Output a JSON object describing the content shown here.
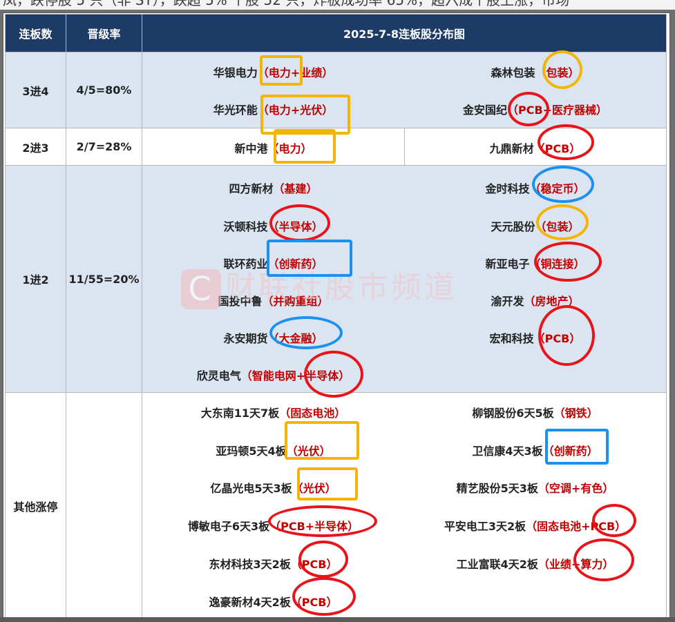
{
  "top_text": "凤，跌停股 5 只（非 ST），跌超 5% 个股 52 只，炸板成功率 65%，超六成个股上涨，市场",
  "header": {
    "col1": "连板数",
    "col2": "晋级率",
    "col3": "2025-7-8连板股分布图"
  },
  "rows": [
    {
      "tier": "3进4",
      "rate": "4/5=80%",
      "left": [
        {
          "name": "华银电力",
          "tag": "（电力+业绩）"
        },
        {
          "name": "华光环能",
          "tag": "（电力+光伏）"
        }
      ],
      "right": [
        {
          "name": "森林包装",
          "tag": "（包装）"
        },
        {
          "name": "金安国纪",
          "tag": "（PCB+医疗器械）"
        }
      ]
    },
    {
      "tier": "2进3",
      "rate": "2/7=28%",
      "left": [
        {
          "name": "新中港",
          "tag": "（电力）"
        }
      ],
      "right": [
        {
          "name": "九鼎新材",
          "tag": "（PCB）"
        }
      ]
    },
    {
      "tier": "1进2",
      "rate": "11/55=20%",
      "left": [
        {
          "name": "四方新材",
          "tag": "（基建）"
        },
        {
          "name": "沃顿科技",
          "tag": "（半导体）"
        },
        {
          "name": "联环药业",
          "tag": "（创新药）"
        },
        {
          "name": "国投中鲁",
          "tag": "（并购重组）"
        },
        {
          "name": "永安期货",
          "tag": "（大金融）"
        },
        {
          "name": "欣灵电气",
          "tag": "（智能电网+半导体）"
        }
      ],
      "right": [
        {
          "name": "金时科技",
          "tag": "（稳定币）"
        },
        {
          "name": "天元股份",
          "tag": "（包装）"
        },
        {
          "name": "新亚电子",
          "tag": "（铜连接）"
        },
        {
          "name": "渝开发",
          "tag": "（房地产）"
        },
        {
          "name": "宏和科技",
          "tag": "（PCB）"
        }
      ]
    },
    {
      "tier": "其他涨停",
      "rate": "",
      "left": [
        {
          "name": "大东南11天7板",
          "tag": "（固态电池）"
        },
        {
          "name": "亚玛顿5天4板",
          "tag": "（光伏）"
        },
        {
          "name": "亿晶光电5天3板",
          "tag": "（光伏）"
        },
        {
          "name": "博敏电子6天3板",
          "tag": "（PCB+半导体）"
        },
        {
          "name": "东材科技3天2板",
          "tag": "（PCB）"
        },
        {
          "name": "逸豪新材4天2板",
          "tag": "（PCB）"
        }
      ],
      "right": [
        {
          "name": "柳钢股份6天5板",
          "tag": "（钢铁）"
        },
        {
          "name": "卫信康4天3板",
          "tag": "（创新药）"
        },
        {
          "name": "精艺股份5天3板",
          "tag": "（空调+有色）"
        },
        {
          "name": "平安电工3天2板",
          "tag": "（固态电池+PCB）"
        },
        {
          "name": "工业富联4天2板",
          "tag": "（业绩+算力）"
        }
      ]
    }
  ],
  "watermark": "财联社股市频道",
  "colors": {
    "header_bg": "#1e3a66",
    "band_blue": "#dbe5f1",
    "tag_red": "#c00000",
    "mark_red": "#e8141a",
    "mark_yellow": "#f5b400",
    "mark_blue": "#1a90f0"
  }
}
